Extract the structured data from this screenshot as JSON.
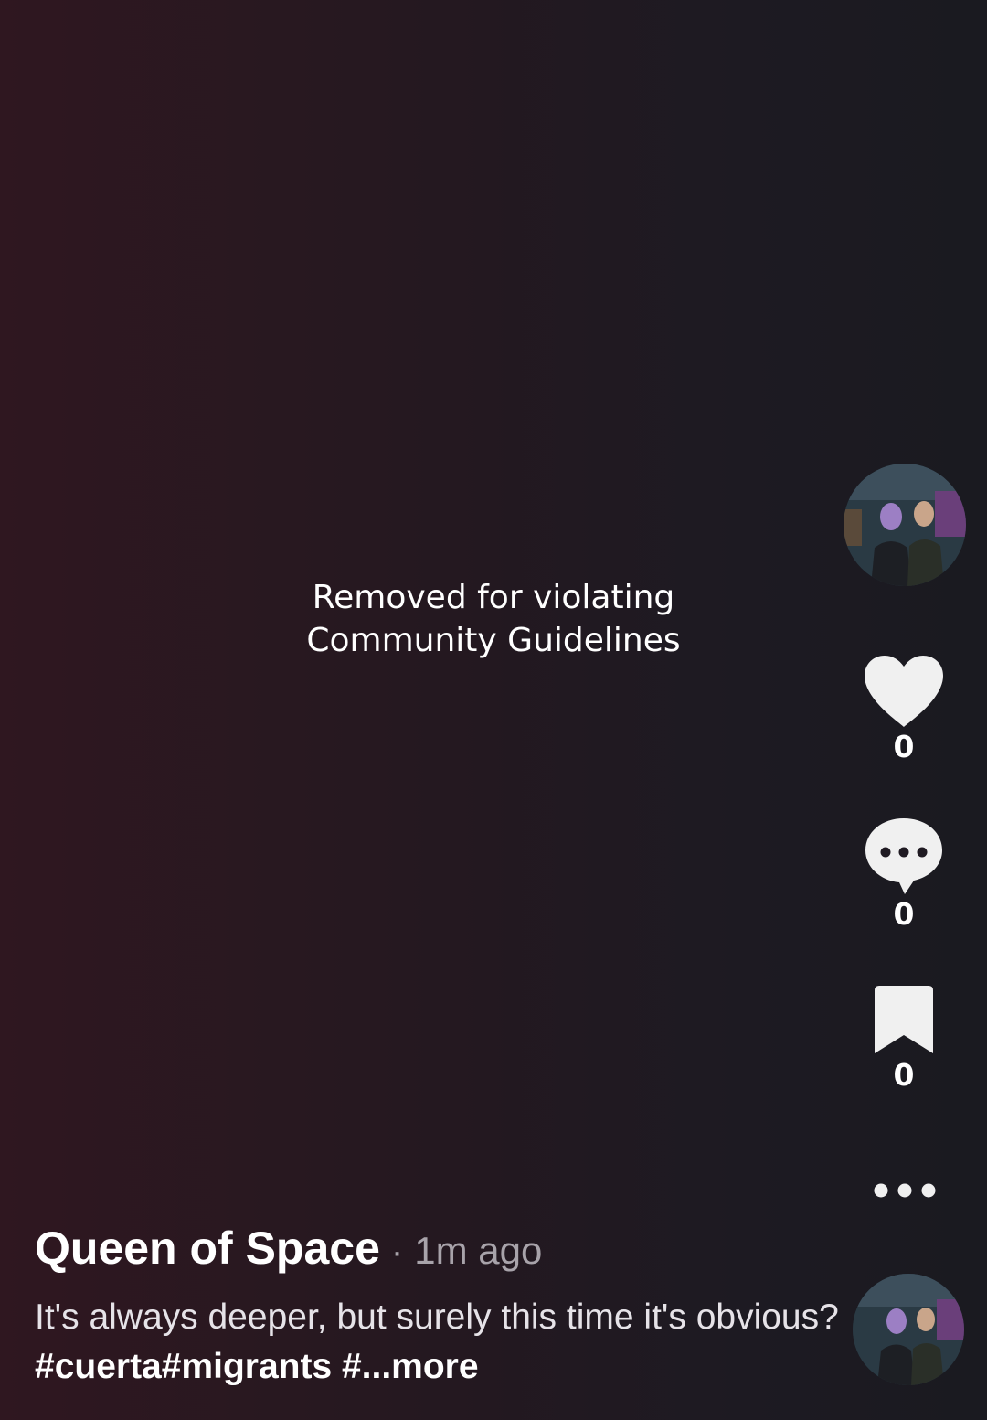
{
  "video": {
    "status_message_line1": "Removed for violating",
    "status_message_line2": "Community Guidelines"
  },
  "actions": {
    "like_count": "0",
    "comment_count": "0",
    "save_count": "0"
  },
  "post": {
    "author": "Queen of Space",
    "separator": "·",
    "time_ago": "1m ago",
    "caption_text": "It's always deeper, but surely this time it's obvious? ",
    "hashtags": "#cuerta#migrants #",
    "more_label": "...more"
  },
  "colors": {
    "background_left": "#2f1720",
    "background_right": "#1a1a20",
    "icon_fill": "#f0f0f0",
    "muted_text": "#a8a3aa"
  },
  "icons": {
    "like": "heart-icon",
    "comment": "comment-bubble-icon",
    "save": "bookmark-icon",
    "more": "more-dots-icon"
  }
}
